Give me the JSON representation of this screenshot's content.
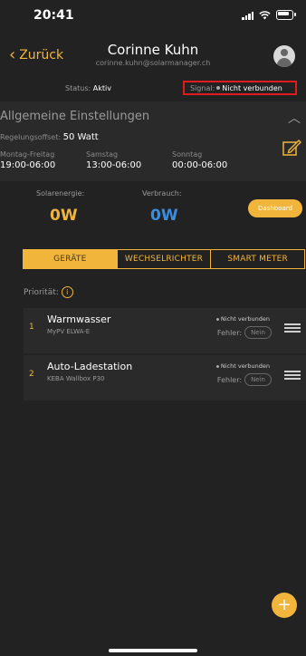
{
  "status_bar": {
    "time": "20:41",
    "signal_icon": "cellular-signal-icon",
    "wifi_icon": "wifi-icon",
    "battery_icon": "battery-icon"
  },
  "header": {
    "back_label": "Zurück",
    "user_name": "Corinne Kuhn",
    "user_email": "corinne.kuhn@solarmanager.ch",
    "avatar_icon": "user-avatar-icon"
  },
  "status": {
    "status_label": "Status:",
    "status_value": "Aktiv",
    "signal_label": "Signal:",
    "signal_value": "Nicht verbunden"
  },
  "settings": {
    "heading": "Allgemeine Einstellungen",
    "offset_label": "Regelungsoffset:",
    "offset_value": "50 Watt",
    "schedule": [
      {
        "label": "Montag-Freitag",
        "value": "19:00-06:00"
      },
      {
        "label": "Samstag",
        "value": "13:00-06:00"
      },
      {
        "label": "Sonntag",
        "value": "00:00-06:00"
      }
    ]
  },
  "energy": {
    "solar_label": "Solarenergie:",
    "solar_value": "0W",
    "consumption_label": "Verbrauch:",
    "consumption_value": "0W",
    "dashboard_label": "Dashboard"
  },
  "tabs": [
    "GERÄTE",
    "WECHSELRICHTER",
    "SMART METER"
  ],
  "priority_label": "Priorität:",
  "devices": [
    {
      "index": "1",
      "name": "Warmwasser",
      "model": "MyPV ELWA-E",
      "connection": "Nicht verbunden",
      "error_label": "Fehler:",
      "error_value": "Nein"
    },
    {
      "index": "2",
      "name": "Auto-Ladestation",
      "model": "KEBA Wallbox P30",
      "connection": "Nicht verbunden",
      "error_label": "Fehler:",
      "error_value": "Nein"
    }
  ],
  "fab_label": "+",
  "colors": {
    "accent": "#f2b53c",
    "solar": "#f2b53c",
    "consumption": "#3b8ede",
    "alert_border": "#e01c1c",
    "background": "#222222"
  }
}
